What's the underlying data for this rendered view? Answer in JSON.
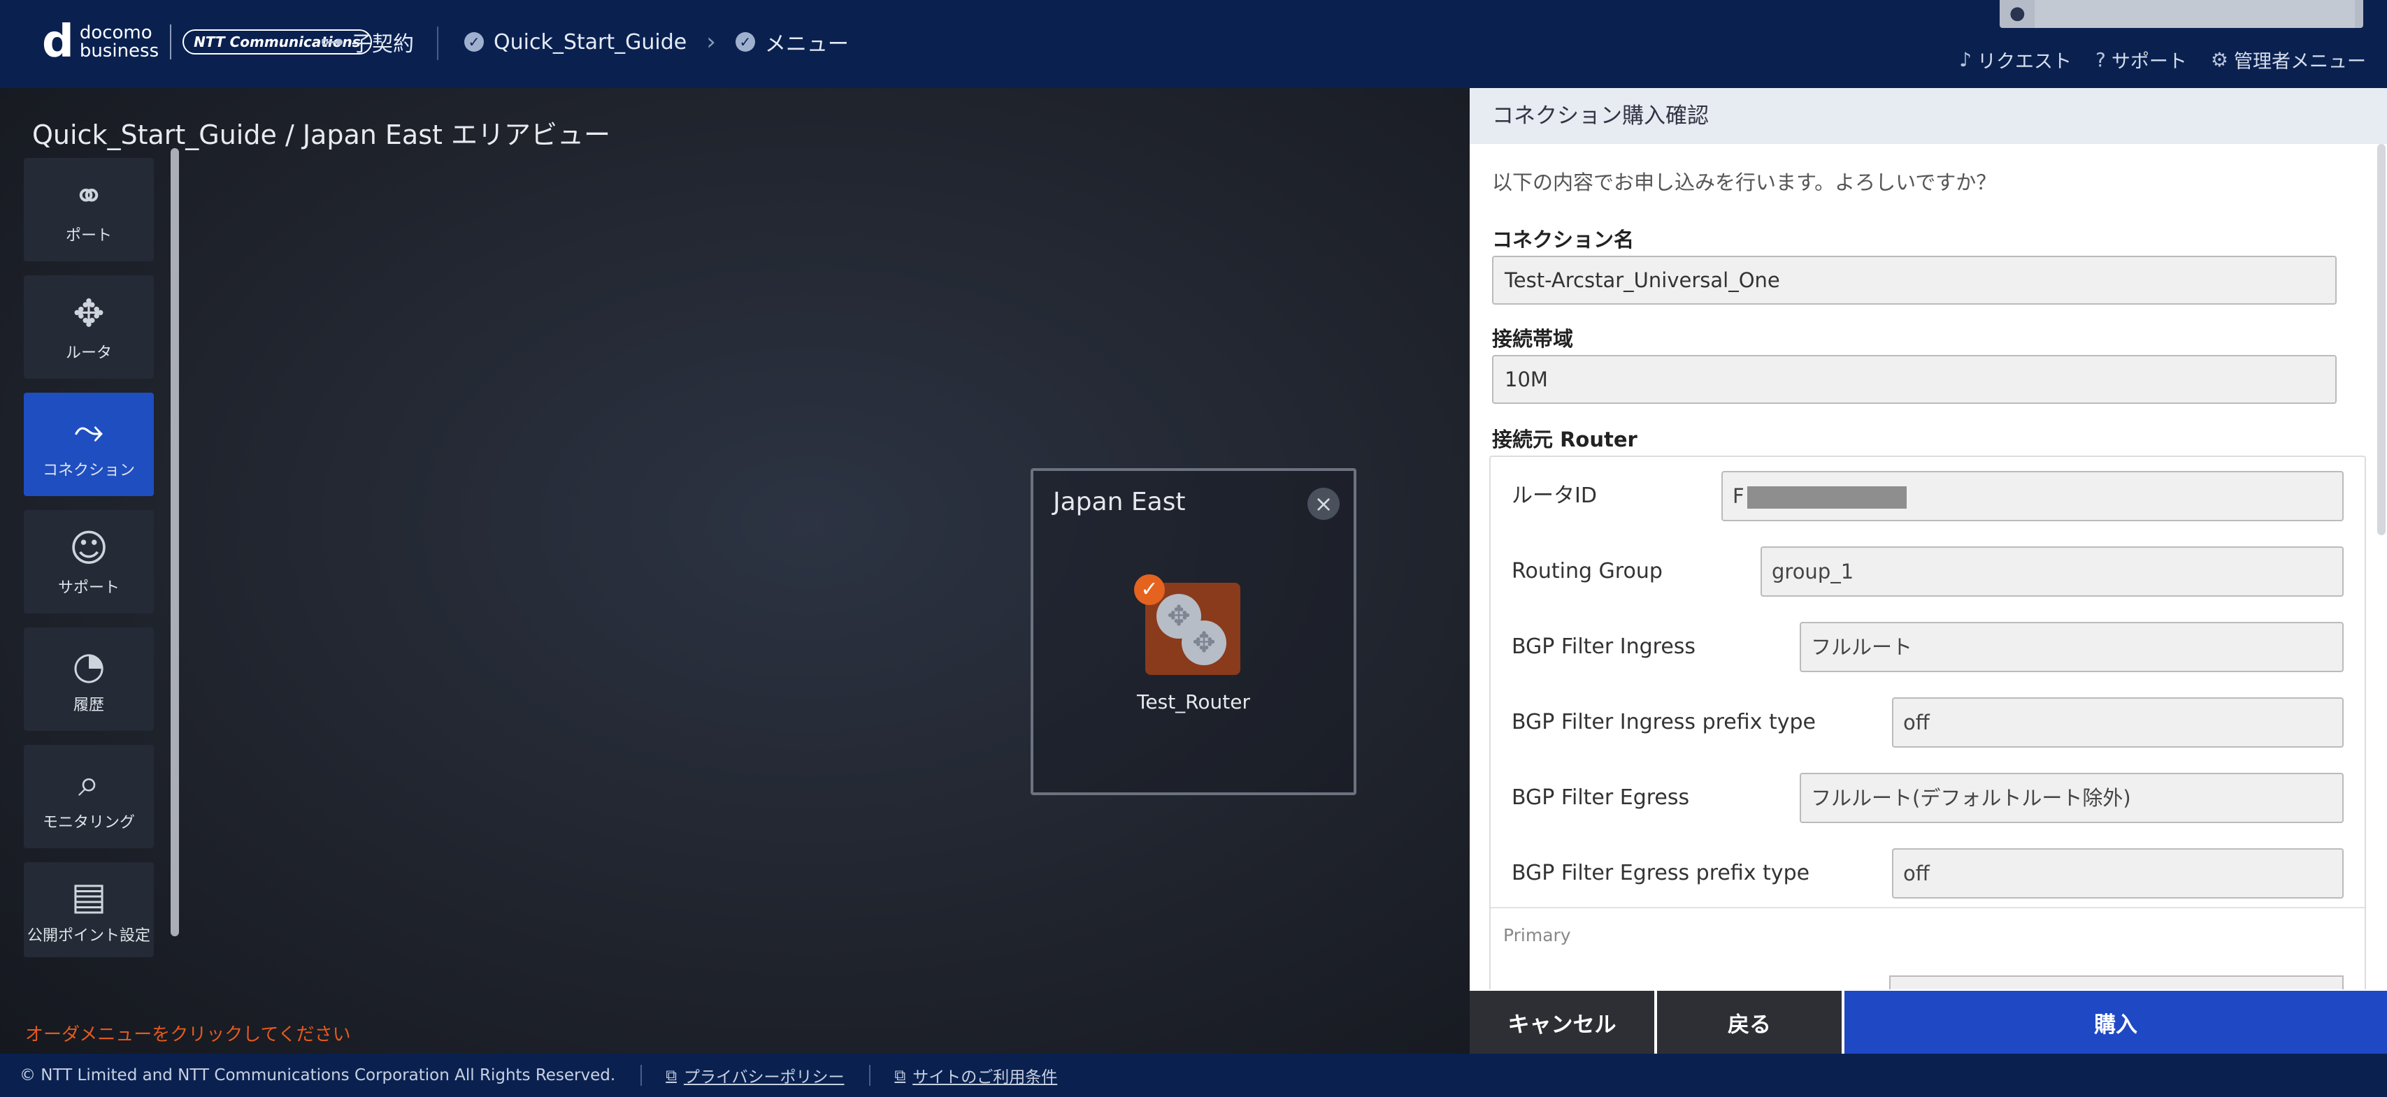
{
  "header": {
    "brand_top": "docomo",
    "brand_bottom": "business",
    "ntt_logo": "NTT Communications",
    "sub_contract": "子契約",
    "breadcrumb": [
      "Quick_Start_Guide",
      "メニュー"
    ],
    "links": {
      "request": "リクエスト",
      "support": "サポート",
      "admin_menu": "管理者メニュー"
    }
  },
  "canvas": {
    "title": "Quick_Start_Guide / Japan East エリアビュー",
    "hint": "オーダメニューをクリックしてください",
    "region": {
      "name": "Japan East",
      "router_label": "Test_Router"
    }
  },
  "sidebar": {
    "items": [
      {
        "label": "ポート",
        "icon": "port-icon"
      },
      {
        "label": "ルータ",
        "icon": "router-icon"
      },
      {
        "label": "コネクション",
        "icon": "connection-icon",
        "active": true
      },
      {
        "label": "サポート",
        "icon": "support-user-icon"
      },
      {
        "label": "履歴",
        "icon": "history-icon"
      },
      {
        "label": "モニタリング",
        "icon": "monitoring-icon"
      },
      {
        "label": "公開ポイント設定",
        "icon": "public-point-icon"
      }
    ]
  },
  "panel": {
    "title": "コネクション購入確認",
    "intro": "以下の内容でお申し込みを行います。よろしいですか？",
    "connection_name_label": "コネクション名",
    "connection_name": "Test-Arcstar_Universal_One",
    "bandwidth_label": "接続帯域",
    "bandwidth": "10M",
    "source_router_label": "接続元 Router",
    "router": {
      "router_id_label": "ルータID",
      "router_id_prefix": "F",
      "routing_group_label": "Routing Group",
      "routing_group": "group_1",
      "ingress_label": "BGP Filter Ingress",
      "ingress": "フルルート",
      "ingress_prefix_label": "BGP Filter Ingress prefix type",
      "ingress_prefix": "off",
      "egress_label": "BGP Filter Egress",
      "egress": "フルルート(デフォルトルート除外)",
      "egress_prefix_label": "BGP Filter Egress prefix type",
      "egress_prefix": "off",
      "primary_label": "Primary"
    },
    "buttons": {
      "cancel": "キャンセル",
      "back": "戻る",
      "purchase": "購入"
    }
  },
  "footer": {
    "copyright": "© NTT Limited and NTT Communications Corporation All Rights Reserved.",
    "privacy": "プライバシーポリシー",
    "terms": "サイトのご利用条件"
  }
}
